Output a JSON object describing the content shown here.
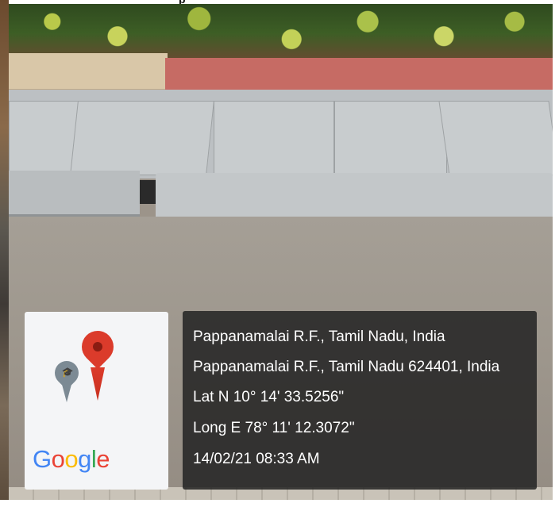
{
  "top_caption": "p",
  "location": {
    "line1": "Pappanamalai R.F., Tamil Nadu, India",
    "line2": "Pappanamalai R.F., Tamil Nadu 624401, India",
    "lat": "Lat N 10° 14' 33.5256\"",
    "long": "Long E 78° 11' 12.3072\"",
    "datetime": "14/02/21 08:33 AM"
  },
  "logo": {
    "brand_parts": [
      "G",
      "o",
      "o",
      "g",
      "l",
      "e"
    ],
    "icons": [
      "map-pin-icon",
      "graduation-cap-pin-icon"
    ]
  },
  "colors": {
    "pin_red": "#db3b2b",
    "google_blue": "#4285f4",
    "google_red": "#ea4335",
    "google_yellow": "#fbbc05",
    "google_green": "#34a853"
  }
}
